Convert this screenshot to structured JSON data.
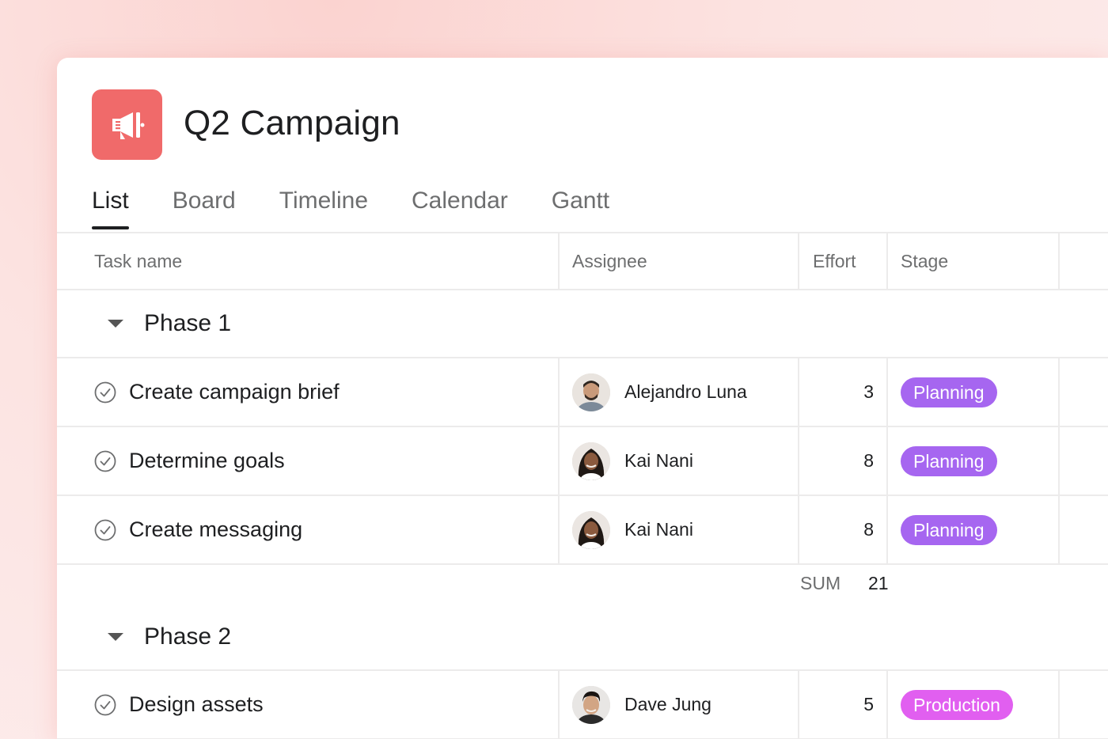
{
  "project": {
    "title": "Q2 Campaign",
    "icon": "megaphone-icon",
    "icon_bg": "#f06a6a"
  },
  "tabs": [
    {
      "label": "List",
      "active": true
    },
    {
      "label": "Board",
      "active": false
    },
    {
      "label": "Timeline",
      "active": false
    },
    {
      "label": "Calendar",
      "active": false
    },
    {
      "label": "Gantt",
      "active": false
    }
  ],
  "columns": {
    "task": "Task name",
    "assignee": "Assignee",
    "effort": "Effort",
    "stage": "Stage"
  },
  "sections": [
    {
      "title": "Phase 1",
      "tasks": [
        {
          "name": "Create campaign brief",
          "assignee": "Alejandro Luna",
          "effort": "3",
          "stage": "Planning"
        },
        {
          "name": "Determine goals",
          "assignee": "Kai Nani",
          "effort": "8",
          "stage": "Planning"
        },
        {
          "name": "Create messaging",
          "assignee": "Kai Nani",
          "effort": "8",
          "stage": "Planning"
        }
      ],
      "sum_label": "SUM",
      "sum_value": "21"
    },
    {
      "title": "Phase 2",
      "tasks": [
        {
          "name": "Design assets",
          "assignee": "Dave Jung",
          "effort": "5",
          "stage": "Production"
        }
      ]
    }
  ],
  "stage_colors": {
    "Planning": "#a666f0",
    "Production": "#e15ff0"
  }
}
